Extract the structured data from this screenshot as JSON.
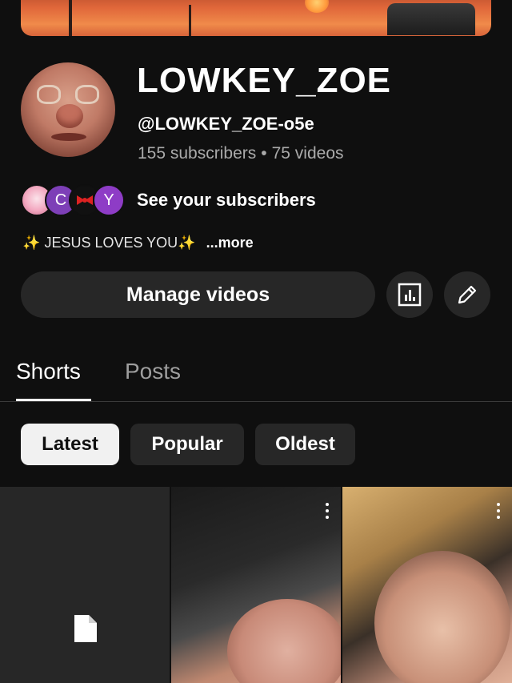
{
  "channel": {
    "name": "LOWKEY_ZOE",
    "handle": "@LOWKEY_ZOE-o5e",
    "subscribers": "155 subscribers",
    "separator": "•",
    "videos": "75 videos"
  },
  "subscribers_preview": {
    "avatars": [
      "",
      "C",
      "",
      "Y"
    ],
    "label": "See your subscribers"
  },
  "description": {
    "sparkle": "✨",
    "text": "JESUS LOVES YOU",
    "more": "...more"
  },
  "actions": {
    "manage_label": "Manage videos",
    "analytics_icon": "analytics-icon",
    "edit_icon": "pencil-icon"
  },
  "tabs": [
    {
      "label": "Shorts",
      "active": true
    },
    {
      "label": "Posts",
      "active": false
    }
  ],
  "filters": [
    {
      "label": "Latest",
      "selected": true
    },
    {
      "label": "Popular",
      "selected": false
    },
    {
      "label": "Oldest",
      "selected": false
    }
  ],
  "colors": {
    "background": "#0f0f0f",
    "surface": "#272727",
    "text": "#f1f1f1",
    "muted": "#aaaaaa"
  }
}
